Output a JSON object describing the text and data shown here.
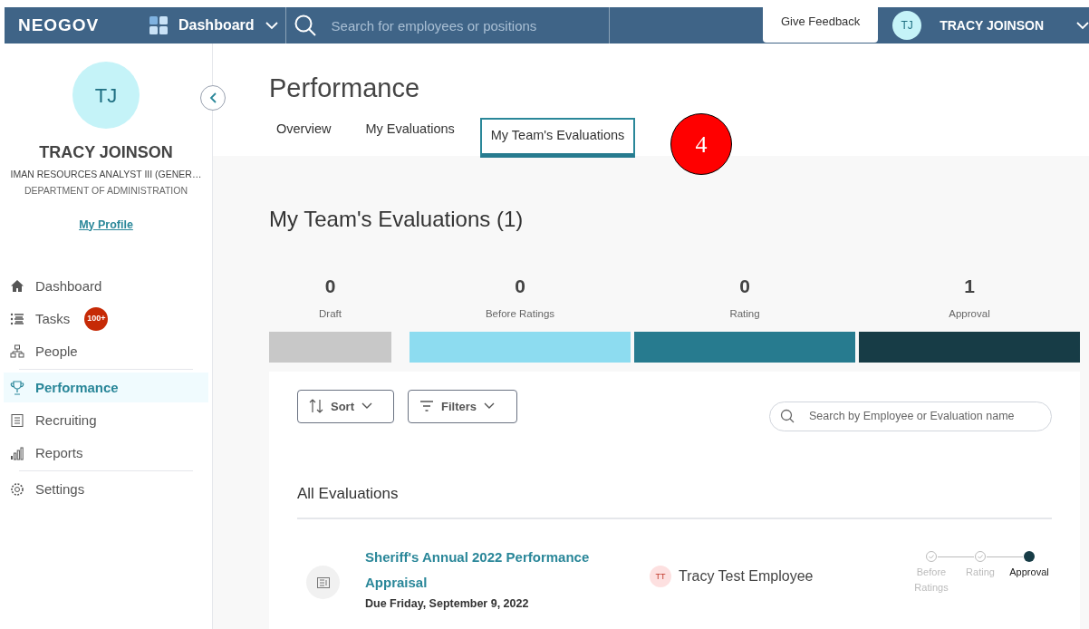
{
  "topbar": {
    "logo": "NEOGOV",
    "app_menu": "Dashboard",
    "search": {
      "placeholder": "Search for employees or positions"
    },
    "feedback": "Give Feedback",
    "user": {
      "initials": "TJ",
      "name": "TRACY JOINSON"
    }
  },
  "profile": {
    "initials": "TJ",
    "name": "TRACY JOINSON",
    "title": "IMAN RESOURCES ANALYST III (GENER…",
    "department": "DEPARTMENT OF ADMINISTRATION",
    "link": "My Profile"
  },
  "nav": [
    {
      "kind": "home",
      "label": "Dashboard",
      "selected": false
    },
    {
      "kind": "tasks",
      "label": "Tasks",
      "badge": "100+",
      "selected": false
    },
    {
      "kind": "people",
      "label": "People",
      "selected": false,
      "divider_after": true
    },
    {
      "kind": "trophy",
      "label": "Performance",
      "selected": true
    },
    {
      "kind": "clipboard",
      "label": "Recruiting",
      "selected": false
    },
    {
      "kind": "chart",
      "label": "Reports",
      "selected": false,
      "divider_after": true
    },
    {
      "kind": "gear",
      "label": "Settings",
      "selected": false
    }
  ],
  "page_title": "Performance",
  "tabs": [
    {
      "label": "Overview",
      "selected": false
    },
    {
      "label": "My Evaluations",
      "selected": false
    },
    {
      "label": "My Team's Evaluations",
      "selected": true
    }
  ],
  "callout": "4",
  "section_title": "My Team's Evaluations (1)",
  "stages": [
    {
      "count": "0",
      "label": "Draft",
      "color": "#c8c8c8"
    },
    {
      "count": "0",
      "label": "Before Ratings",
      "color": "#8ddcf0"
    },
    {
      "count": "0",
      "label": "Rating",
      "color": "#277b8f"
    },
    {
      "count": "1",
      "label": "Approval",
      "color": "#173c46"
    }
  ],
  "sort_button": "Sort",
  "filters_button": "Filters",
  "eval_search": {
    "placeholder": "Search by Employee or Evaluation name"
  },
  "list_title": "All Evaluations",
  "evaluations": [
    {
      "title": "Sheriff's Annual 2022 Performance Appraisal",
      "due": "Due Friday, September 9, 2022",
      "employee": {
        "initials": "TT",
        "name": "Tracy Test Employee"
      },
      "steps": [
        {
          "label": "Before Ratings",
          "kind": "done"
        },
        {
          "label": "Rating",
          "kind": "done"
        },
        {
          "label": "Approval",
          "kind": "current"
        }
      ]
    }
  ]
}
